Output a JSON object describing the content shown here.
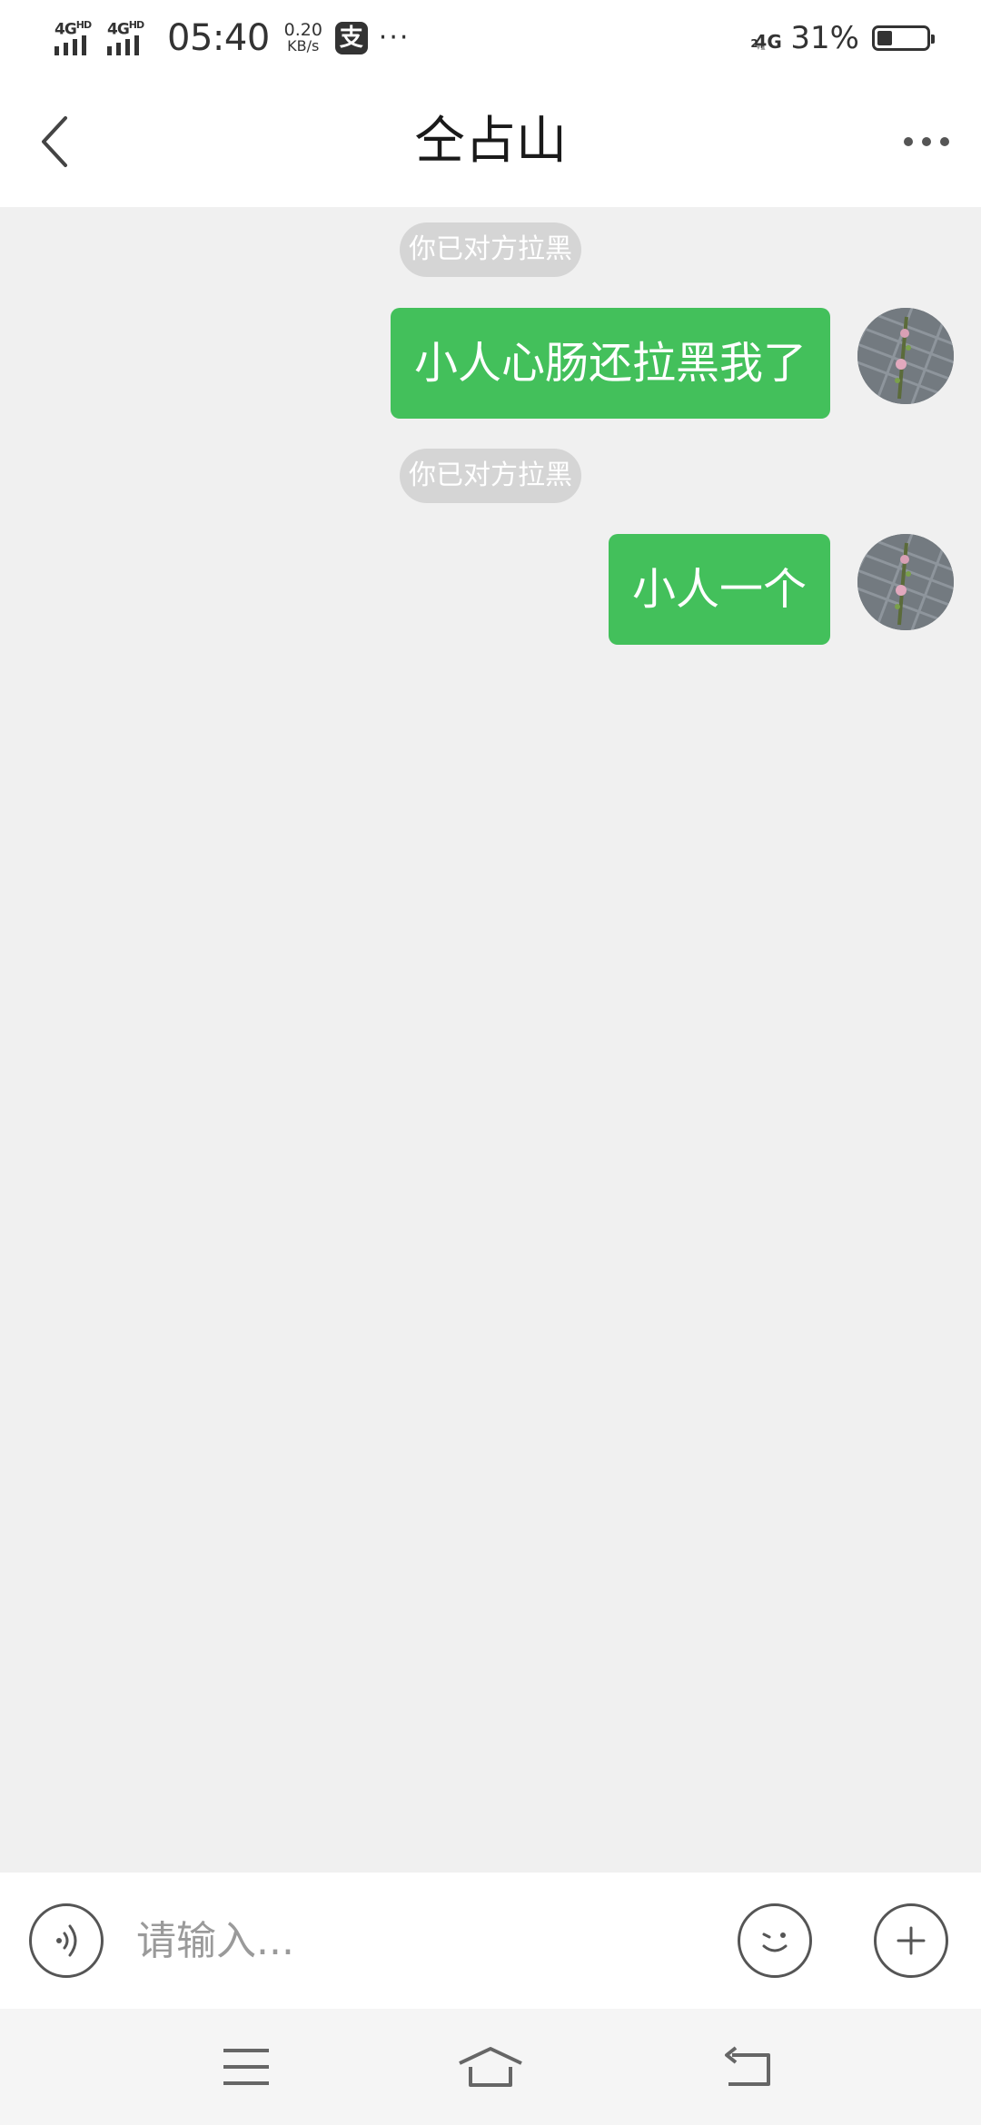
{
  "status_bar": {
    "sim1": "4G",
    "sim1_sup": "HD",
    "sim2": "4G",
    "sim2_sup": "HD",
    "time": "05:40",
    "speed_value": "0.20",
    "speed_unit": "KB/s",
    "alipay_glyph": "支",
    "more": "···",
    "network": "4G",
    "network_sub": "2",
    "battery_percent": "31%",
    "battery_level": 0.31
  },
  "header": {
    "title": "仝占山",
    "back_icon": "chevron-left-icon",
    "more_icon": "more-dots-icon"
  },
  "messages": [
    {
      "type": "system",
      "text": "你已对方拉黑"
    },
    {
      "type": "outgoing",
      "text": "小人心肠还拉黑我了"
    },
    {
      "type": "system",
      "text": "你已对方拉黑"
    },
    {
      "type": "outgoing",
      "text": "小人一个"
    }
  ],
  "input_bar": {
    "placeholder": "请输入...",
    "value": "",
    "voice_icon": "voice-icon",
    "emoji_icon": "emoji-icon",
    "add_icon": "plus-icon"
  },
  "system_nav": {
    "menu_icon": "menu-icon",
    "home_icon": "home-icon",
    "back_icon": "back-icon"
  },
  "colors": {
    "bubble": "#43c05b",
    "chat_bg": "#f0f0f0",
    "system_tag": "#d5d5d5"
  }
}
